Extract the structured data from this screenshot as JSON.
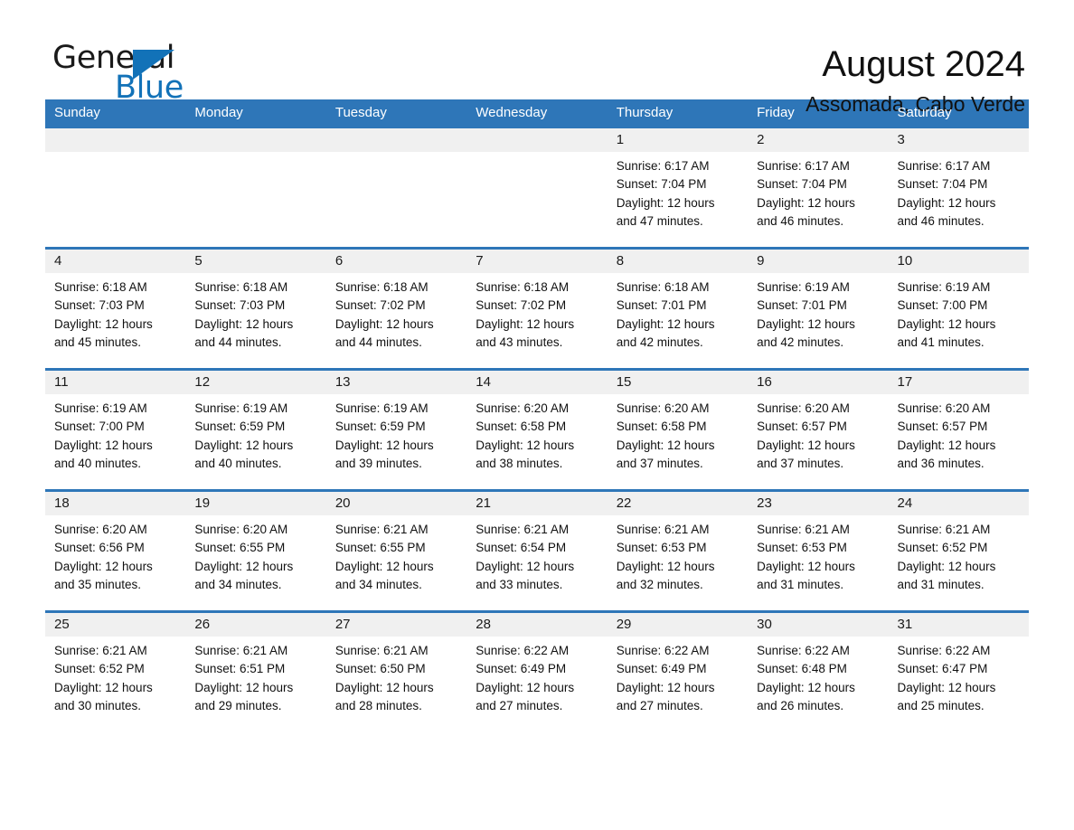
{
  "brand": {
    "word_one": "General",
    "word_two": "Blue",
    "triangle_icon": "triangle-icon",
    "accent_color": "#1272b8"
  },
  "header": {
    "title": "August 2024",
    "subtitle": "Assomada, Cabo Verde"
  },
  "calendar": {
    "header_bg": "#2e76b8",
    "day_band_bg": "#f0f0f0",
    "weekdays": [
      "Sunday",
      "Monday",
      "Tuesday",
      "Wednesday",
      "Thursday",
      "Friday",
      "Saturday"
    ],
    "weeks": [
      [
        {
          "day": "",
          "lines": []
        },
        {
          "day": "",
          "lines": []
        },
        {
          "day": "",
          "lines": []
        },
        {
          "day": "",
          "lines": []
        },
        {
          "day": "1",
          "lines": [
            "Sunrise: 6:17 AM",
            "Sunset: 7:04 PM",
            "Daylight: 12 hours",
            "and 47 minutes."
          ]
        },
        {
          "day": "2",
          "lines": [
            "Sunrise: 6:17 AM",
            "Sunset: 7:04 PM",
            "Daylight: 12 hours",
            "and 46 minutes."
          ]
        },
        {
          "day": "3",
          "lines": [
            "Sunrise: 6:17 AM",
            "Sunset: 7:04 PM",
            "Daylight: 12 hours",
            "and 46 minutes."
          ]
        }
      ],
      [
        {
          "day": "4",
          "lines": [
            "Sunrise: 6:18 AM",
            "Sunset: 7:03 PM",
            "Daylight: 12 hours",
            "and 45 minutes."
          ]
        },
        {
          "day": "5",
          "lines": [
            "Sunrise: 6:18 AM",
            "Sunset: 7:03 PM",
            "Daylight: 12 hours",
            "and 44 minutes."
          ]
        },
        {
          "day": "6",
          "lines": [
            "Sunrise: 6:18 AM",
            "Sunset: 7:02 PM",
            "Daylight: 12 hours",
            "and 44 minutes."
          ]
        },
        {
          "day": "7",
          "lines": [
            "Sunrise: 6:18 AM",
            "Sunset: 7:02 PM",
            "Daylight: 12 hours",
            "and 43 minutes."
          ]
        },
        {
          "day": "8",
          "lines": [
            "Sunrise: 6:18 AM",
            "Sunset: 7:01 PM",
            "Daylight: 12 hours",
            "and 42 minutes."
          ]
        },
        {
          "day": "9",
          "lines": [
            "Sunrise: 6:19 AM",
            "Sunset: 7:01 PM",
            "Daylight: 12 hours",
            "and 42 minutes."
          ]
        },
        {
          "day": "10",
          "lines": [
            "Sunrise: 6:19 AM",
            "Sunset: 7:00 PM",
            "Daylight: 12 hours",
            "and 41 minutes."
          ]
        }
      ],
      [
        {
          "day": "11",
          "lines": [
            "Sunrise: 6:19 AM",
            "Sunset: 7:00 PM",
            "Daylight: 12 hours",
            "and 40 minutes."
          ]
        },
        {
          "day": "12",
          "lines": [
            "Sunrise: 6:19 AM",
            "Sunset: 6:59 PM",
            "Daylight: 12 hours",
            "and 40 minutes."
          ]
        },
        {
          "day": "13",
          "lines": [
            "Sunrise: 6:19 AM",
            "Sunset: 6:59 PM",
            "Daylight: 12 hours",
            "and 39 minutes."
          ]
        },
        {
          "day": "14",
          "lines": [
            "Sunrise: 6:20 AM",
            "Sunset: 6:58 PM",
            "Daylight: 12 hours",
            "and 38 minutes."
          ]
        },
        {
          "day": "15",
          "lines": [
            "Sunrise: 6:20 AM",
            "Sunset: 6:58 PM",
            "Daylight: 12 hours",
            "and 37 minutes."
          ]
        },
        {
          "day": "16",
          "lines": [
            "Sunrise: 6:20 AM",
            "Sunset: 6:57 PM",
            "Daylight: 12 hours",
            "and 37 minutes."
          ]
        },
        {
          "day": "17",
          "lines": [
            "Sunrise: 6:20 AM",
            "Sunset: 6:57 PM",
            "Daylight: 12 hours",
            "and 36 minutes."
          ]
        }
      ],
      [
        {
          "day": "18",
          "lines": [
            "Sunrise: 6:20 AM",
            "Sunset: 6:56 PM",
            "Daylight: 12 hours",
            "and 35 minutes."
          ]
        },
        {
          "day": "19",
          "lines": [
            "Sunrise: 6:20 AM",
            "Sunset: 6:55 PM",
            "Daylight: 12 hours",
            "and 34 minutes."
          ]
        },
        {
          "day": "20",
          "lines": [
            "Sunrise: 6:21 AM",
            "Sunset: 6:55 PM",
            "Daylight: 12 hours",
            "and 34 minutes."
          ]
        },
        {
          "day": "21",
          "lines": [
            "Sunrise: 6:21 AM",
            "Sunset: 6:54 PM",
            "Daylight: 12 hours",
            "and 33 minutes."
          ]
        },
        {
          "day": "22",
          "lines": [
            "Sunrise: 6:21 AM",
            "Sunset: 6:53 PM",
            "Daylight: 12 hours",
            "and 32 minutes."
          ]
        },
        {
          "day": "23",
          "lines": [
            "Sunrise: 6:21 AM",
            "Sunset: 6:53 PM",
            "Daylight: 12 hours",
            "and 31 minutes."
          ]
        },
        {
          "day": "24",
          "lines": [
            "Sunrise: 6:21 AM",
            "Sunset: 6:52 PM",
            "Daylight: 12 hours",
            "and 31 minutes."
          ]
        }
      ],
      [
        {
          "day": "25",
          "lines": [
            "Sunrise: 6:21 AM",
            "Sunset: 6:52 PM",
            "Daylight: 12 hours",
            "and 30 minutes."
          ]
        },
        {
          "day": "26",
          "lines": [
            "Sunrise: 6:21 AM",
            "Sunset: 6:51 PM",
            "Daylight: 12 hours",
            "and 29 minutes."
          ]
        },
        {
          "day": "27",
          "lines": [
            "Sunrise: 6:21 AM",
            "Sunset: 6:50 PM",
            "Daylight: 12 hours",
            "and 28 minutes."
          ]
        },
        {
          "day": "28",
          "lines": [
            "Sunrise: 6:22 AM",
            "Sunset: 6:49 PM",
            "Daylight: 12 hours",
            "and 27 minutes."
          ]
        },
        {
          "day": "29",
          "lines": [
            "Sunrise: 6:22 AM",
            "Sunset: 6:49 PM",
            "Daylight: 12 hours",
            "and 27 minutes."
          ]
        },
        {
          "day": "30",
          "lines": [
            "Sunrise: 6:22 AM",
            "Sunset: 6:48 PM",
            "Daylight: 12 hours",
            "and 26 minutes."
          ]
        },
        {
          "day": "31",
          "lines": [
            "Sunrise: 6:22 AM",
            "Sunset: 6:47 PM",
            "Daylight: 12 hours",
            "and 25 minutes."
          ]
        }
      ]
    ]
  }
}
